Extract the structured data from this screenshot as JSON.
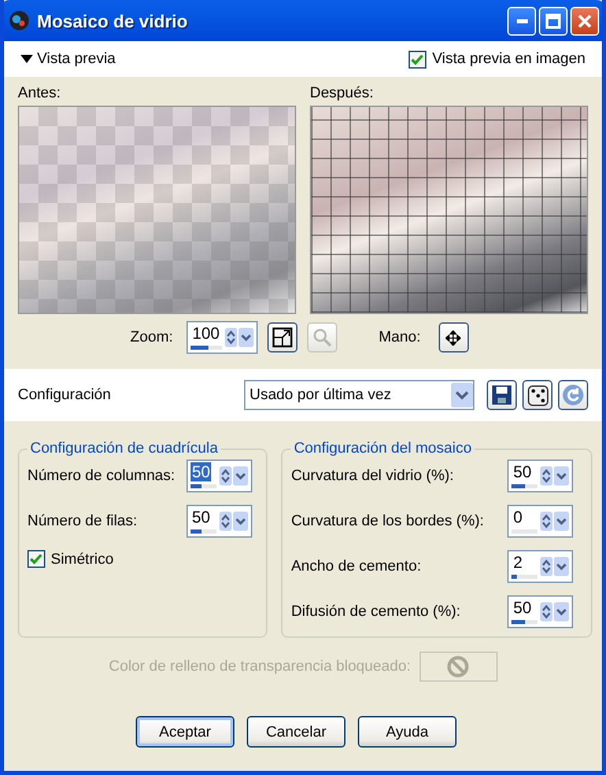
{
  "window": {
    "title": "Mosaico de vidrio"
  },
  "preview_toggle": {
    "label": "Vista previa",
    "expanded": true
  },
  "preview_on_image": {
    "label": "Vista previa en imagen",
    "checked": true
  },
  "before": {
    "label": "Antes:"
  },
  "after": {
    "label": "Después:"
  },
  "zoom": {
    "label": "Zoom:",
    "value": "100",
    "level": 0.55
  },
  "hand": {
    "label": "Mano:"
  },
  "settings": {
    "label": "Configuración",
    "preset": "Usado por última vez"
  },
  "grid_group": {
    "title": "Configuración de cuadrícula",
    "fields": [
      {
        "label": "Número de columnas:",
        "value": "50",
        "level": 0.4,
        "focused": true
      },
      {
        "label": "Número de filas:",
        "value": "50",
        "level": 0.4,
        "focused": false
      }
    ],
    "symmetric": {
      "label": "Simétrico",
      "checked": true
    }
  },
  "mosaic_group": {
    "title": "Configuración del mosaico",
    "fields": [
      {
        "label": "Curvatura del vidrio (%):",
        "value": "50",
        "level": 0.5,
        "focused": false
      },
      {
        "label": "Curvatura de los bordes (%):",
        "value": "0",
        "level": 0,
        "focused": false
      },
      {
        "label": "Ancho de cemento:",
        "value": "2",
        "level": 0.2,
        "focused": false
      },
      {
        "label": "Difusión de cemento (%):",
        "value": "50",
        "level": 0.5,
        "focused": false
      }
    ]
  },
  "fill_color": {
    "label": "Color de relleno de transparencia bloqueado:",
    "disabled": true
  },
  "buttons": [
    {
      "label": "Aceptar",
      "default": true
    },
    {
      "label": "Cancelar",
      "default": false
    },
    {
      "label": "Ayuda",
      "default": false
    }
  ]
}
